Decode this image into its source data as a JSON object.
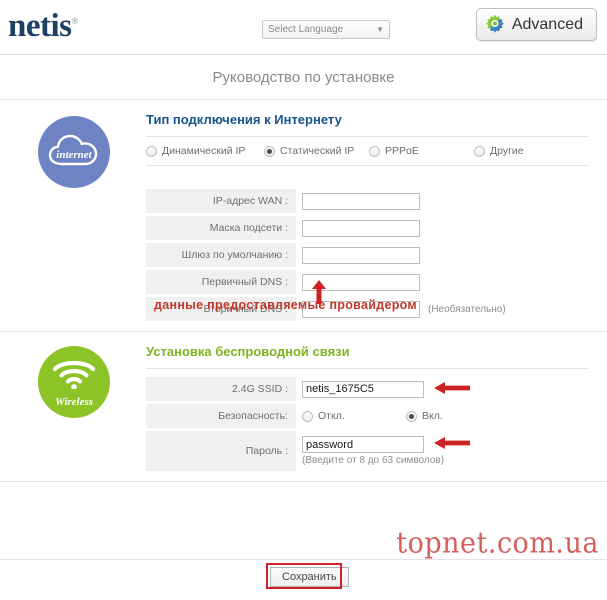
{
  "header": {
    "logo_text": "netis",
    "logo_mark": "®",
    "language_label": "Select Language",
    "language_caret": "▼",
    "advanced_label": "Advanced",
    "gear_icon": "gear-icon"
  },
  "page": {
    "title": "Руководство по установке"
  },
  "internet_section": {
    "badge_caption": "internet",
    "badge_icon": "cloud-icon",
    "heading": "Тип подключения к Интернету",
    "connection_types": [
      {
        "label": "Динамический IP",
        "selected": false
      },
      {
        "label": "Статический IP",
        "selected": true
      },
      {
        "label": "PPPoE",
        "selected": false
      },
      {
        "label": "Другие",
        "selected": false
      }
    ],
    "annotation": "данные предоставляемые провайдером",
    "fields": [
      {
        "label": "IP-адрес WAN :",
        "value": "",
        "hint": ""
      },
      {
        "label": "Маска подсети :",
        "value": "",
        "hint": ""
      },
      {
        "label": "Шлюз по умолчанию :",
        "value": "",
        "hint": ""
      },
      {
        "label": "Первичный DNS :",
        "value": "",
        "hint": ""
      },
      {
        "label": "Вторичный DNS :",
        "value": "",
        "hint": "(Необязательно)"
      }
    ]
  },
  "wireless_section": {
    "badge_caption": "Wireless",
    "badge_icon": "wifi-icon",
    "heading": "Установка беспроводной связи",
    "ssid_label": "2.4G SSID :",
    "ssid_value": "netis_1675C5",
    "security_label": "Безопасность:",
    "security_options": [
      {
        "label": "Откл.",
        "selected": false
      },
      {
        "label": "Вкл.",
        "selected": true
      }
    ],
    "password_label": "Пароль :",
    "password_value": "password",
    "password_hint": "(Введите от 8 до 63 символов)"
  },
  "footer": {
    "save_label": "Сохранить",
    "watermark": "topnet.com.ua"
  },
  "colors": {
    "brand_navy": "#1c3f66",
    "internet_blue": "#6d83c4",
    "wireless_green": "#8cc326",
    "heading_blue": "#18548f",
    "heading_green": "#7db421",
    "annotation_red": "#c0392b",
    "highlight_red": "#d0202a"
  }
}
